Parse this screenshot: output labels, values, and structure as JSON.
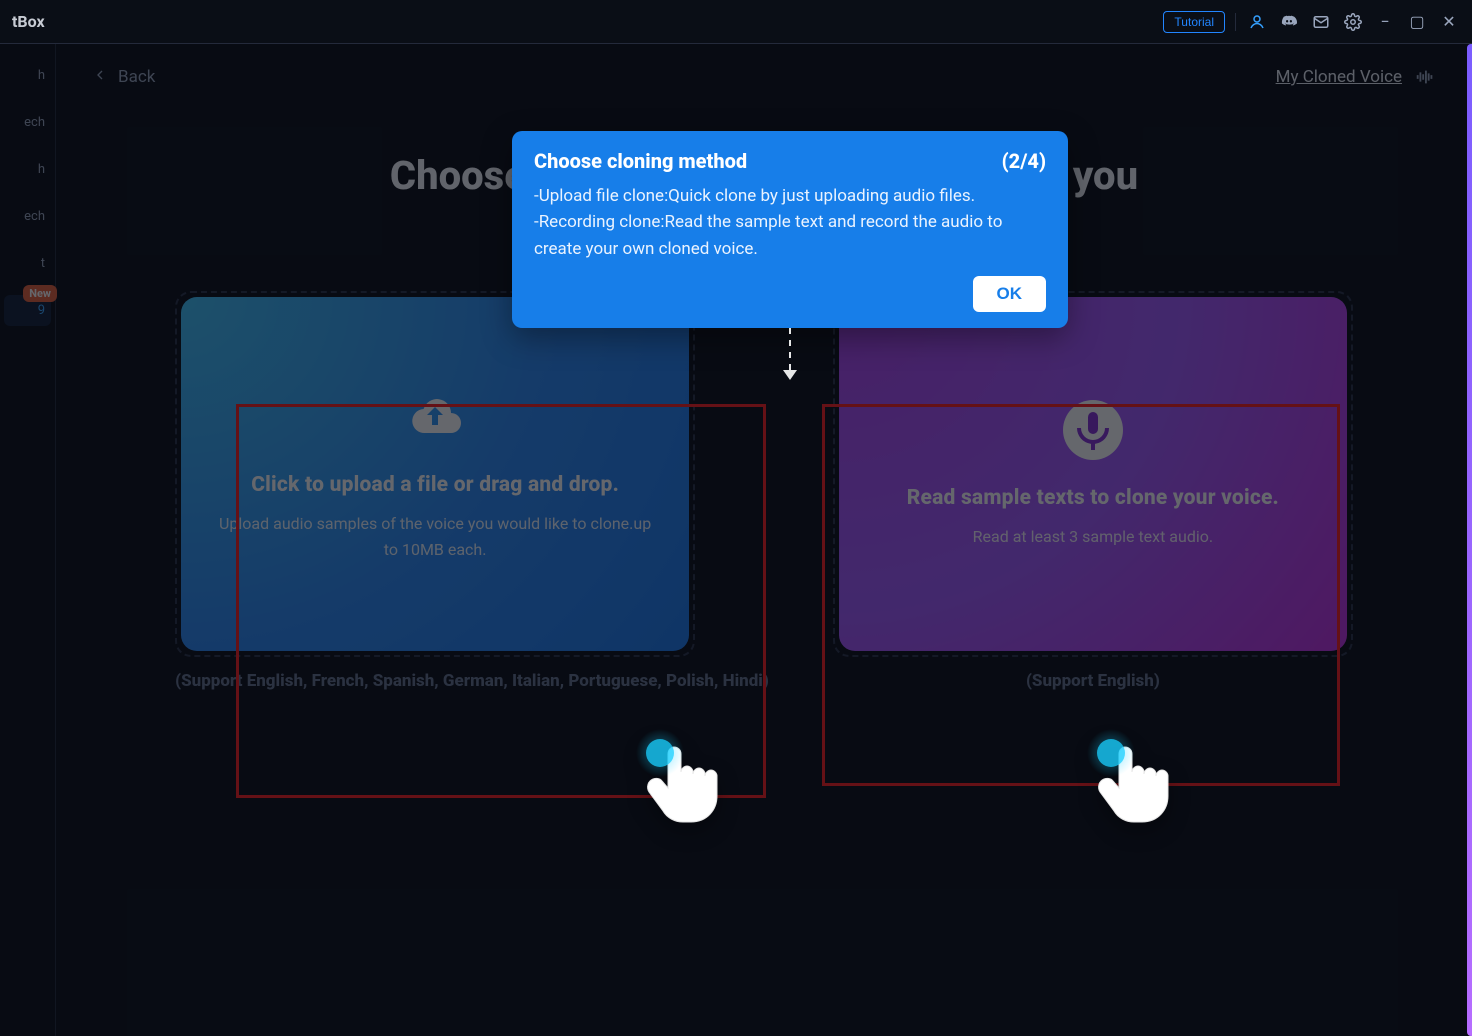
{
  "app": {
    "title_suffix": "tBox"
  },
  "header": {
    "tutorial": "Tutorial",
    "icons": {
      "account": "account-icon",
      "discord": "discord-icon",
      "mail": "mail-icon",
      "gear": "gear-icon"
    },
    "window": {
      "minimize": "−",
      "maximize": "▢",
      "close": "✕"
    }
  },
  "sidebar": {
    "items": [
      {
        "label": "h"
      },
      {
        "label": "ech"
      },
      {
        "label": "h"
      },
      {
        "label": "ech"
      },
      {
        "label": "t"
      },
      {
        "label": "9"
      },
      {
        "label": " "
      }
    ],
    "badge_new": "New"
  },
  "page": {
    "back": "Back",
    "my_cloned_voice": "My Cloned Voice",
    "title": "Choose the cloning method that suits you"
  },
  "popover": {
    "title": "Choose cloning method",
    "step": "(2/4)",
    "line1": "-Upload file clone:Quick clone by just uploading audio files.",
    "line2": "-Recording clone:Read the sample text and record the audio to create your own cloned voice.",
    "ok": "OK"
  },
  "cards": {
    "upload": {
      "title": "Click to upload a file or drag and drop.",
      "desc": "Upload audio samples of the voice you would like to clone.up to 10MB each.",
      "support": "(Support English, French, Spanish, German, Italian, Portuguese, Polish, Hindi)"
    },
    "record": {
      "title": "Read sample texts to clone your voice.",
      "desc": "Read at least 3 sample text audio.",
      "support": "(Support English)"
    }
  }
}
